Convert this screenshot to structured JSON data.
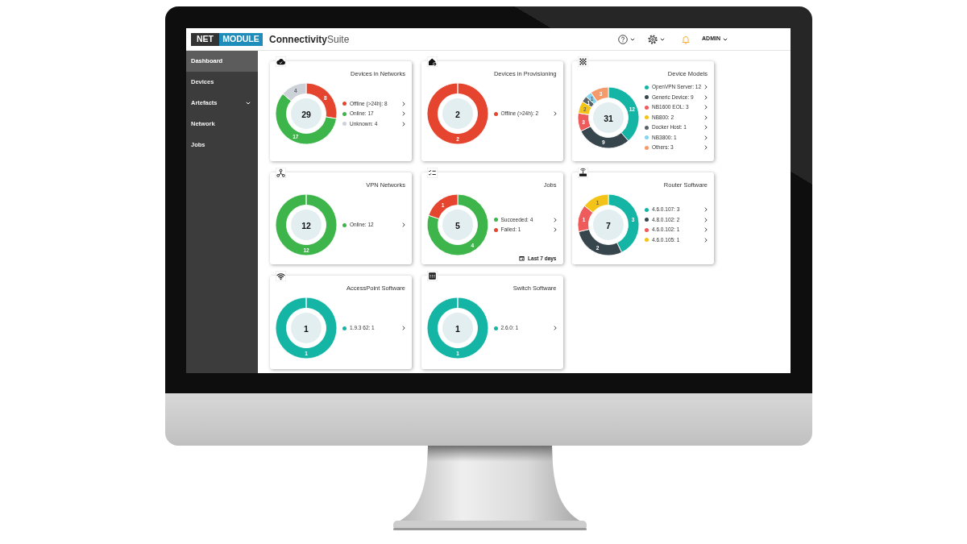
{
  "header": {
    "logo": {
      "left": "NET",
      "right": "MODULE"
    },
    "app_name": "**Connectivity**Suite",
    "user_menu": "ADMIN"
  },
  "sidebar": {
    "items": [
      {
        "label": "Dashboard",
        "kind": "link",
        "selected": true
      },
      {
        "label": "Devices",
        "kind": "link",
        "selected": false
      },
      {
        "label": "Artefacts",
        "kind": "group",
        "selected": false,
        "expanded": false
      },
      {
        "label": "Network",
        "kind": "link",
        "selected": false
      },
      {
        "label": "Jobs",
        "kind": "link",
        "selected": false
      }
    ]
  },
  "cards": [
    {
      "title": "Devices in Networks",
      "total": "29",
      "chart_data": {
        "type": "donut",
        "values": [
          8,
          17,
          4
        ],
        "value_labels": [
          "8",
          "17",
          "4"
        ]
      },
      "legend": [
        {
          "label": "Offline (>24h): 8",
          "color": "#e5452f"
        },
        {
          "label": "Online: 17",
          "color": "#3db54a"
        },
        {
          "label": "Unknown: 4",
          "color": "#cdd2d8"
        }
      ]
    },
    {
      "title": "Devices in Provisioning",
      "total": "2",
      "chart_data": {
        "type": "donut",
        "values": [
          2
        ],
        "value_labels": [
          "2"
        ]
      },
      "legend": [
        {
          "label": "Offline (>24h): 2",
          "color": "#e5452f"
        }
      ]
    },
    {
      "title": "Device Models",
      "total": "31",
      "chart_data": {
        "type": "donut",
        "values": [
          12,
          9,
          3,
          2,
          1,
          1,
          3
        ],
        "value_labels": [
          "12",
          "9",
          "3",
          "2",
          "1",
          "1",
          "3"
        ]
      },
      "legend": [
        {
          "label": "OpenVPN Server: 12",
          "color": "#14b5a5"
        },
        {
          "label": "Generic Device: 9",
          "color": "#36464c"
        },
        {
          "label": "NB1600 EOL: 3",
          "color": "#ef5a5a"
        },
        {
          "label": "NB800: 2",
          "color": "#f3c318"
        },
        {
          "label": "Docker Host: 1",
          "color": "#596266"
        },
        {
          "label": "NB3800: 1",
          "color": "#86d3ef"
        },
        {
          "label": "Others: 3",
          "color": "#f59a6b"
        }
      ]
    },
    {
      "title": "VPN Networks",
      "total": "12",
      "chart_data": {
        "type": "donut",
        "values": [
          12
        ],
        "value_labels": [
          "12"
        ]
      },
      "legend": [
        {
          "label": "Online: 12",
          "color": "#3db54a"
        }
      ]
    },
    {
      "title": "Jobs",
      "total": "5",
      "chart_data": {
        "type": "donut",
        "values": [
          4,
          1
        ],
        "value_labels": [
          "4",
          "1"
        ]
      },
      "legend": [
        {
          "label": "Succeeded: 4",
          "color": "#3db54a"
        },
        {
          "label": "Failed: 1",
          "color": "#e5452f"
        }
      ],
      "footer": "Last 7 days"
    },
    {
      "title": "Router Software",
      "total": "7",
      "chart_data": {
        "type": "donut",
        "values": [
          3,
          2,
          1,
          1
        ],
        "value_labels": [
          "3",
          "2",
          "1",
          "1"
        ]
      },
      "legend": [
        {
          "label": "4.6.0.107: 3",
          "color": "#14b5a5"
        },
        {
          "label": "4.8.0.102: 2",
          "color": "#36464c"
        },
        {
          "label": "4.6.0.102: 1",
          "color": "#ef5a5a"
        },
        {
          "label": "4.6.0.105: 1",
          "color": "#f3c318"
        }
      ]
    },
    {
      "title": "AccessPoint Software",
      "total": "1",
      "chart_data": {
        "type": "donut",
        "values": [
          1
        ],
        "value_labels": [
          "1"
        ]
      },
      "legend": [
        {
          "label": "1.9.3 62: 1",
          "color": "#14b5a5"
        }
      ]
    },
    {
      "title": "Switch Software",
      "total": "1",
      "chart_data": {
        "type": "donut",
        "values": [
          1
        ],
        "value_labels": [
          "1"
        ]
      },
      "legend": [
        {
          "label": "2.6.0: 1",
          "color": "#14b5a5"
        }
      ]
    }
  ]
}
